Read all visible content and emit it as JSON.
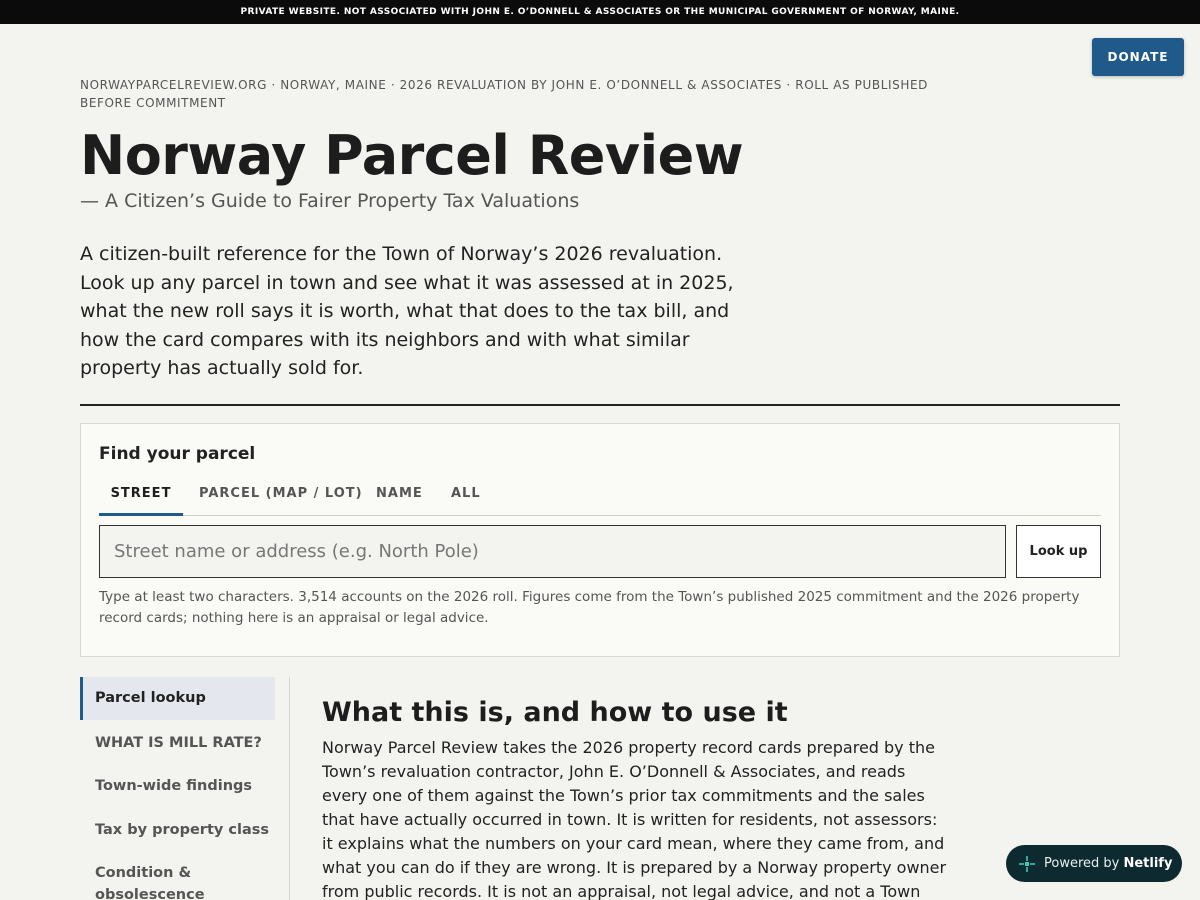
{
  "banner": "PRIVATE WEBSITE. NOT ASSOCIATED WITH JOHN E. O’DONNELL & ASSOCIATES OR THE MUNICIPAL GOVERNMENT OF NORWAY, MAINE.",
  "donate_label": "DONATE",
  "breadcrumb": "NORWAYPARCELREVIEW.ORG · NORWAY, MAINE · 2026 REVALUATION BY JOHN E. O’DONNELL & ASSOCIATES · ROLL AS PUBLISHED BEFORE COMMITMENT",
  "title": "Norway Parcel Review",
  "subtitle": "— A Citizen’s Guide to Fairer Property Tax Valuations",
  "intro": "A citizen-built reference for the Town of Norway’s 2026 revaluation. Look up any parcel in town and see what it was assessed at in 2025, what the new roll says it is worth, what that does to the tax bill, and how the card compares with its neighbors and with what similar property has actually sold for.",
  "finder": {
    "title": "Find your parcel",
    "tabs": [
      "STREET",
      "PARCEL (MAP / LOT)",
      "NAME",
      "ALL"
    ],
    "active_tab": "STREET",
    "search_placeholder": "Street name or address (e.g. North Pole)",
    "search_value": "",
    "lookup_label": "Look up",
    "hint": "Type at least two characters. 3,514 accounts on the 2026 roll. Figures come from the Town’s published 2025 commitment and the 2026 property record cards; nothing here is an appraisal or legal advice."
  },
  "sidebar": {
    "items": [
      {
        "label": "Parcel lookup",
        "active": true
      },
      {
        "label": "WHAT IS MILL RATE?",
        "active": false
      },
      {
        "label": "Town-wide findings",
        "active": false
      },
      {
        "label": "Tax by property class",
        "active": false
      },
      {
        "label": "Condition & obsolescence guide",
        "active": false
      }
    ]
  },
  "main": {
    "heading": "What this is, and how to use it",
    "paragraph": "Norway Parcel Review takes the 2026 property record cards prepared by the Town’s revaluation contractor, John E. O’Donnell & Associates, and reads every one of them against the Town’s prior tax commitments and the sales that have actually occurred in town. It is written for residents, not assessors: it explains what the numbers on your card mean, where they came from, and what you can do if they are wrong. It is prepared by a Norway property owner from public records. It is not an appraisal, not legal advice, and not a Town publication. Why these records are"
  },
  "netlify_badge": {
    "prefix": "Powered by ",
    "brand": "Netlify"
  },
  "colors": {
    "accent": "#1f5a8a",
    "background": "#f3f3ef",
    "banner": "#0b0b0b",
    "netlify": "#0d2a30"
  }
}
